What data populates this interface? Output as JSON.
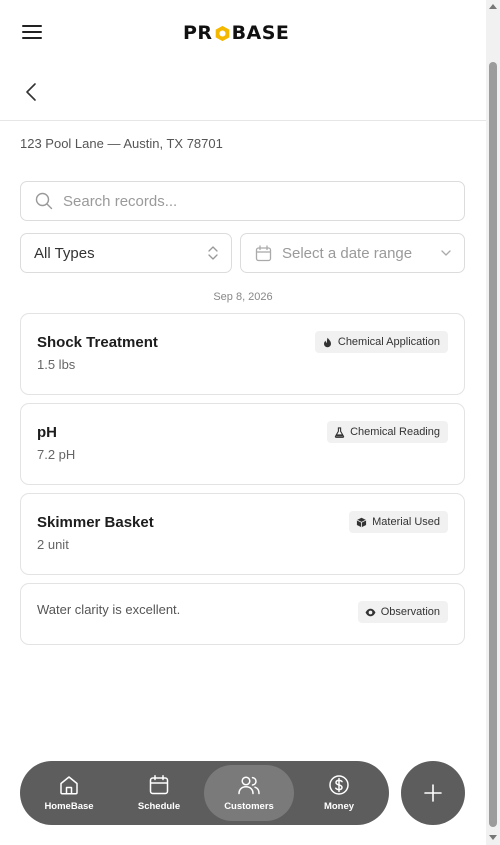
{
  "header": {
    "logo_left": "PR",
    "logo_right": "BASE",
    "brand_color": "#f5b800"
  },
  "address": "123 Pool Lane — Austin, TX 78701",
  "search": {
    "placeholder": "Search records..."
  },
  "filters": {
    "type_selected": "All Types",
    "date_placeholder": "Select a date range"
  },
  "date_group": "Sep 8, 2026",
  "records": [
    {
      "title": "Shock Treatment",
      "sub": "1.5 lbs",
      "tag": "Chemical Application",
      "tag_icon": "flame-icon"
    },
    {
      "title": "pH",
      "sub": "7.2 pH",
      "tag": "Chemical Reading",
      "tag_icon": "flask-icon"
    },
    {
      "title": "Skimmer Basket",
      "sub": "2 unit",
      "tag": "Material Used",
      "tag_icon": "box-icon"
    },
    {
      "note": "Water clarity is excellent.",
      "tag": "Observation",
      "tag_icon": "eye-icon"
    }
  ],
  "nav": {
    "items": [
      {
        "label": "HomeBase",
        "icon": "home-icon"
      },
      {
        "label": "Schedule",
        "icon": "calendar-icon"
      },
      {
        "label": "Customers",
        "icon": "users-icon",
        "active": true
      },
      {
        "label": "Money",
        "icon": "dollar-icon"
      }
    ],
    "fab_icon": "plus-icon"
  }
}
